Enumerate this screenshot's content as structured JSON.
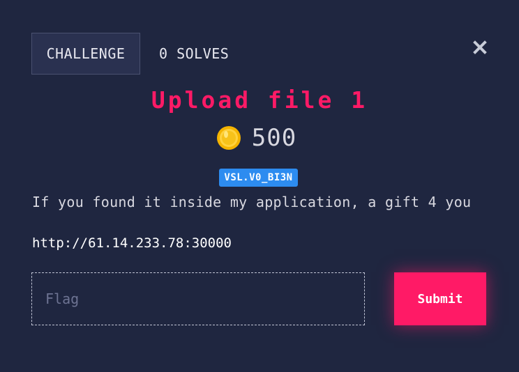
{
  "tabs": {
    "challenge_label": "CHALLENGE",
    "solves_label": "0 SOLVES"
  },
  "close_icon": "close-icon",
  "challenge": {
    "title": "Upload file 1",
    "value": "500",
    "value_icon": "coin-icon",
    "tag": "VSL.V0_BI3N",
    "description": "If you found it inside my application, a gift 4 you",
    "link": "http://61.14.233.78:30000"
  },
  "form": {
    "flag_placeholder": "Flag",
    "flag_value": "",
    "submit_label": "Submit"
  },
  "colors": {
    "background": "#1f2640",
    "accent": "#ff1a66",
    "tag": "#2d8cf0"
  }
}
